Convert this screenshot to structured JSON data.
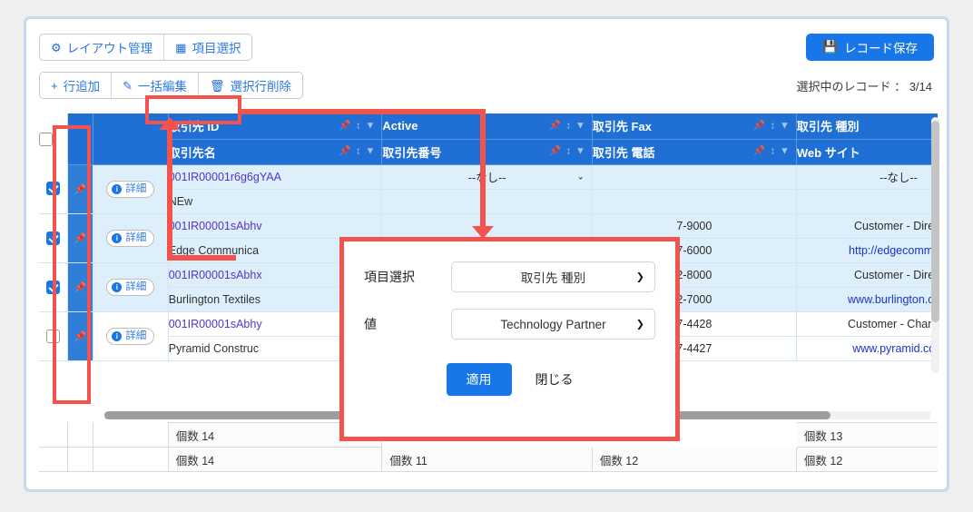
{
  "toolbar": {
    "layout_button": "レイアウト管理",
    "layout_icon": "gear-icon",
    "field_select_button": "項目選択",
    "field_select_icon": "columns-icon",
    "save_button": "レコード保存",
    "save_icon": "save-icon",
    "add_row_button": "行追加",
    "add_row_icon": "plus-icon",
    "bulk_edit_button": "一括編集",
    "bulk_edit_icon": "pencil-square-icon",
    "delete_rows_button": "選択行削除",
    "delete_rows_icon": "trash-icon",
    "record_count_label": "選択中のレコード ： 3/14"
  },
  "grid": {
    "header_icons": {
      "pin": "pin-icon",
      "sort": "sort-icon",
      "filter": "filter-icon"
    },
    "header_row1": [
      "取引先 ID",
      "Active",
      "取引先 Fax",
      "取引先 種別"
    ],
    "header_row2": [
      "取引先名",
      "取引先番号",
      "取引先 電話",
      "Web サイト"
    ],
    "detail_button": "詳細",
    "detail_icon": "info-icon",
    "rows": [
      {
        "checked": true,
        "id": "001IR00001r6g6gYAA",
        "name": "NEw",
        "active": "--なし--",
        "phone_number": "",
        "fax": "",
        "phone": "",
        "type": "--なし--",
        "website": ""
      },
      {
        "checked": true,
        "id": "001IR00001sAbhv",
        "name": "Edge Communica",
        "active": "",
        "phone_number": "",
        "fax": "7-9000",
        "phone": "7-6000",
        "type": "Customer - Direct",
        "website": "http://edgecomm.co"
      },
      {
        "checked": true,
        "id": "001IR00001sAbhx",
        "name": "Burlington Textiles",
        "active": "",
        "phone_number": "",
        "fax": "2-8000",
        "phone": "2-7000",
        "type": "Customer - Direct",
        "website": "www.burlington.com"
      },
      {
        "checked": false,
        "id": "001IR00001sAbhy",
        "name": "Pyramid Construc",
        "active": "",
        "phone_number": "",
        "fax": "7-4428",
        "phone": "7-4427",
        "type": "Customer - Channel",
        "website": "www.pyramid.com"
      }
    ],
    "footer_row1": [
      "個数 14",
      "",
      "",
      "個数 13"
    ],
    "footer_row2": [
      "個数 14",
      "個数 11",
      "個数 12",
      "個数 12"
    ]
  },
  "modal": {
    "field_label": "項目選択",
    "field_value": "取引先 種別",
    "value_label": "値",
    "value_value": "Technology Partner",
    "apply_button": "適用",
    "close_button": "閉じる",
    "chevron_icon": "chevron-down-icon"
  },
  "colors": {
    "accent_blue": "#1877e8",
    "header_blue": "#1f6fd4",
    "annotation_red": "#f4524d",
    "row_selected": "#ddeffb"
  }
}
